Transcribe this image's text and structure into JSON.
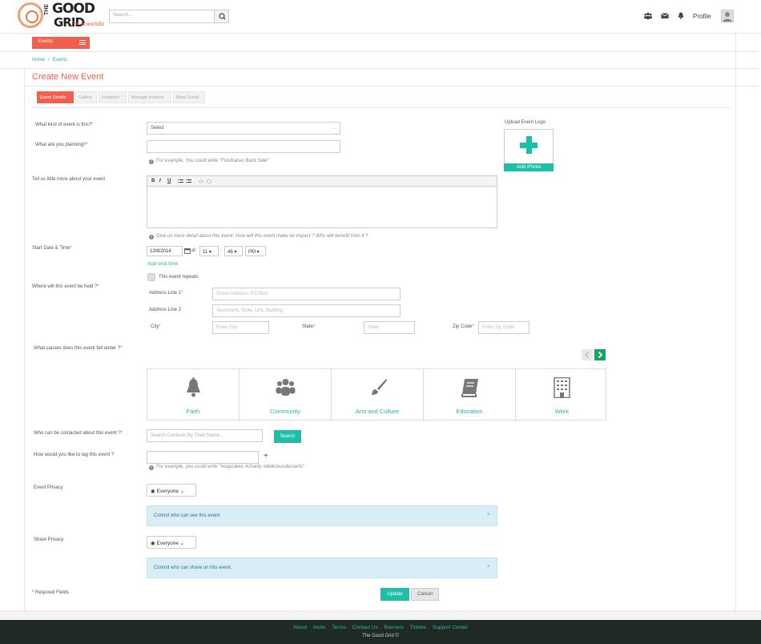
{
  "header": {
    "logo_the": "THE",
    "logo_good": "GOOD",
    "logo_grid": "GRID",
    "logo_sub": "for Rwanda",
    "search_placeholder": "Search...",
    "profile_label": "Profile",
    "icons": [
      "users-icon",
      "envelope-icon",
      "bell-icon",
      "search-icon",
      "user-avatar-icon"
    ]
  },
  "nav": {
    "events_label": "Events"
  },
  "breadcrumb": {
    "home": "Home",
    "separator": "/",
    "current": "Events"
  },
  "page": {
    "title": "Create New Event"
  },
  "tabs": [
    {
      "label": "Event Details",
      "active": true
    },
    {
      "label": "Gallery",
      "active": false
    },
    {
      "label": "Invitation",
      "active": false
    },
    {
      "label": "Manage Invitees",
      "active": false
    },
    {
      "label": "Mass Email",
      "active": false
    }
  ],
  "form": {
    "kind_label": "What kind of event is this?",
    "kind_value": "Select",
    "planning_label": "What are you planning?",
    "planning_help": "For example, You could write \"Fundraiser Back Sale\"",
    "more_label": "Tell us little more about your event",
    "editor_toolbar": [
      "B",
      "I",
      "U"
    ],
    "more_help": "Give us more detail about this event, How will this event make an impact ? Who will benefit from it ?",
    "start_label": "Start Date & Time",
    "start_date": "12/8/2014",
    "at_label": "at",
    "hour": "11",
    "time_sep": ":",
    "minute": "46",
    "ampm": "PM",
    "add_end_time": "Add end time",
    "repeats_label": "This event repeats",
    "where_label": "Where will this event be held ?",
    "addr1_label": "Address Line 1",
    "addr1_placeholder": "Street Address, P.O Box",
    "addr2_label": "Address Line 2",
    "addr2_placeholder": "Apartment, Suite, Unit, Building",
    "city_label": "City",
    "city_placeholder": "Enter City",
    "state_label": "State",
    "state_placeholder": "State",
    "zip_label": "Zip Code",
    "zip_placeholder": "Enter Zip Code",
    "causes_label": "What causes does this event fall under ?",
    "causes": [
      {
        "label": "Faith",
        "icon": "bell-icon"
      },
      {
        "label": "Community",
        "icon": "users-icon"
      },
      {
        "label": "Arts and Culture",
        "icon": "paintbrush-icon"
      },
      {
        "label": "Education",
        "icon": "book-icon"
      },
      {
        "label": "Work",
        "icon": "building-icon"
      }
    ],
    "contact_label": "Who can be contacted about this event ?",
    "contact_placeholder": "Search Contacts By Their Name...",
    "contact_search": "Search",
    "tag_label": "How would you like to tag this event ?",
    "tag_help": "For example, you could write \"#cupcakes #charity #deliciousdesserts\"",
    "tag_add": "+",
    "privacy_label": "Event Privacy",
    "privacy_value": "Everyone",
    "privacy_alert": "Control who can see this event.",
    "share_label": "Share Privacy",
    "share_value": "Everyone",
    "share_alert": "Control who can share on this event.",
    "required_note": "* Required Fields",
    "update_label": "Update",
    "cancel_label": "Cancel",
    "asterisk": "*",
    "alert_close": "×"
  },
  "upload": {
    "label": "Upload Event Logo",
    "button": "Add Photo"
  },
  "footer": {
    "links": [
      "About",
      "Invite",
      "Terms",
      "Contact Us",
      "Banners",
      "Tickets",
      "Support Center"
    ],
    "copyright": "The Good Grid ©"
  },
  "colors": {
    "accent": "#f25f4c",
    "teal": "#1dbfa6",
    "footer_bg": "#1f2a27"
  }
}
